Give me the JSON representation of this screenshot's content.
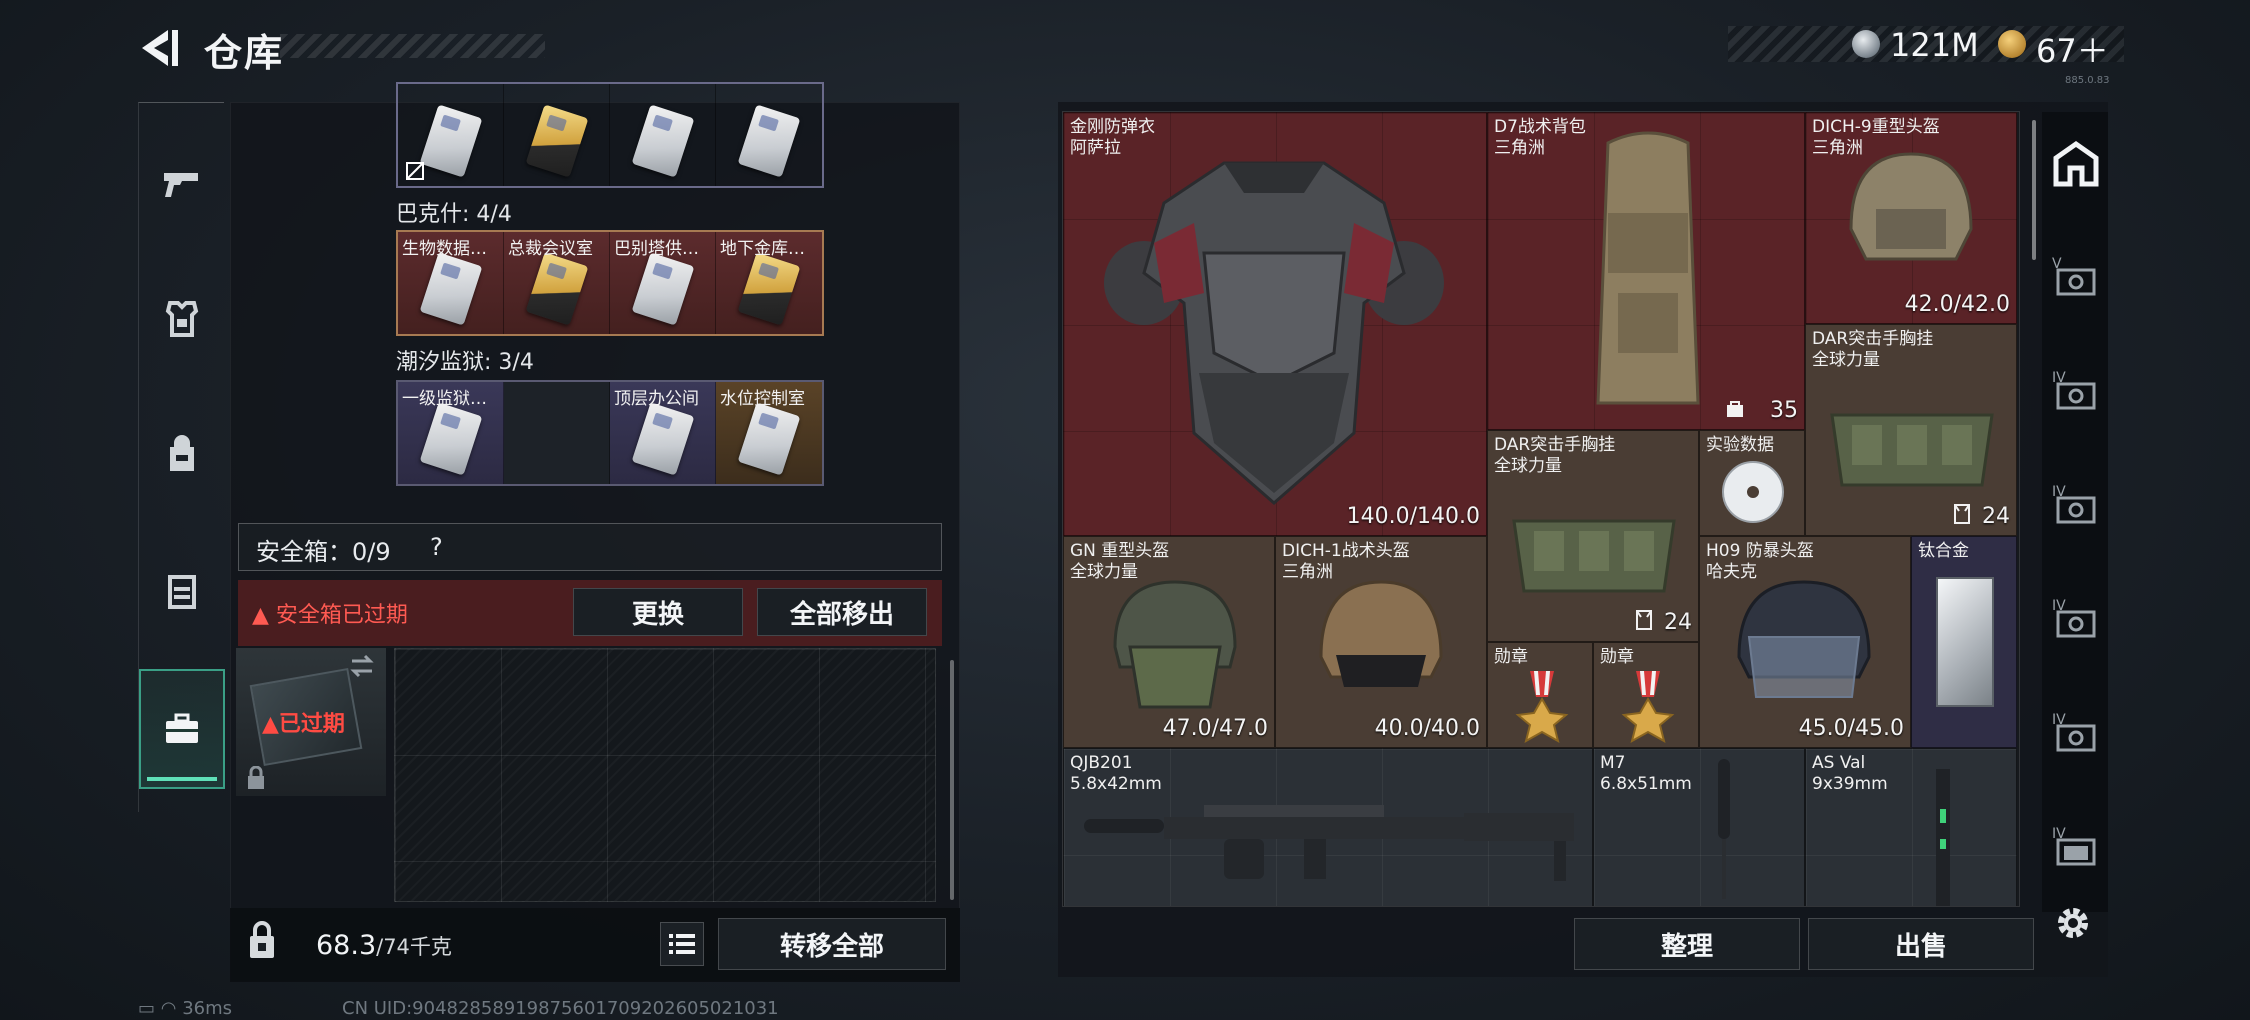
{
  "header": {
    "title": "仓库",
    "money": "121M",
    "tickets": "67＋",
    "version": "885.0.83"
  },
  "colors": {
    "accent_green": "#3a9f86",
    "alert_red": "#ff5a52",
    "legendary_red": "#5a2327",
    "epic_gold": "#5a4327",
    "rare_purple": "#3a3858"
  },
  "left_rail": {
    "tabs": [
      {
        "name": "weapons",
        "icon": "pistol-icon"
      },
      {
        "name": "armor",
        "icon": "armor-icon"
      },
      {
        "name": "backpack",
        "icon": "backpack-icon"
      },
      {
        "name": "chest-rig",
        "icon": "chest-rig-icon"
      },
      {
        "name": "safe-box",
        "icon": "briefcase-icon",
        "active": true
      }
    ]
  },
  "keycards": {
    "group0": {
      "cards": [
        {
          "label": "",
          "rarity": "purple"
        },
        {
          "label": "",
          "rarity": "gold"
        },
        {
          "label": "",
          "rarity": "purple"
        },
        {
          "label": "",
          "rarity": "gold"
        }
      ]
    },
    "group1": {
      "title": "巴克什: 4/4",
      "cards": [
        {
          "label": "生物数据…",
          "rarity": "red"
        },
        {
          "label": "总裁会议室",
          "rarity": "red"
        },
        {
          "label": "巴别塔供…",
          "rarity": "red"
        },
        {
          "label": "地下金库…",
          "rarity": "red"
        }
      ]
    },
    "group2": {
      "title": "潮汐监狱: 3/4",
      "cards": [
        {
          "label": "一级监狱…",
          "rarity": "purple"
        },
        {
          "label": "",
          "rarity": "empty"
        },
        {
          "label": "顶层办公间",
          "rarity": "purple"
        },
        {
          "label": "水位控制室",
          "rarity": "gold"
        }
      ]
    }
  },
  "safe_box": {
    "title": "安全箱：0/9",
    "help": "?",
    "expired_notice": "安全箱已过期",
    "replace_label": "更换",
    "move_all_label": "全部移出",
    "case_status": "已过期"
  },
  "left_footer": {
    "weight": "68.3",
    "weight_limit": "/74千克",
    "transfer_all_label": "转移全部"
  },
  "inventory": {
    "items": [
      {
        "name": "金刚防弹衣",
        "sub": "阿萨拉",
        "dur": "140.0/140.0",
        "rarity": "red"
      },
      {
        "name": "D7战术背包",
        "sub": "三角洲",
        "count": "35",
        "rarity": "red"
      },
      {
        "name": "DICH-9重型头盔",
        "sub": "三角洲",
        "dur": "42.0/42.0",
        "rarity": "red"
      },
      {
        "name": "DAR突击手胸挂",
        "sub": "全球力量",
        "count": "24",
        "rarity": "brown"
      },
      {
        "name": "DAR突击手胸挂",
        "sub": "全球力量",
        "count": "24",
        "rarity": "brown"
      },
      {
        "name": "实验数据",
        "sub": "",
        "rarity": "brown"
      },
      {
        "name": "GN 重型头盔",
        "sub": "全球力量",
        "dur": "47.0/47.0",
        "rarity": "brown"
      },
      {
        "name": "DICH-1战术头盔",
        "sub": "三角洲",
        "dur": "40.0/40.0",
        "rarity": "brown"
      },
      {
        "name": "勋章",
        "sub": "",
        "rarity": "brown"
      },
      {
        "name": "勋章",
        "sub": "",
        "rarity": "brown"
      },
      {
        "name": "H09 防暴头盔",
        "sub": "哈夫克",
        "dur": "45.0/45.0",
        "rarity": "brown"
      },
      {
        "name": "钛合金",
        "sub": "",
        "rarity": "purple"
      },
      {
        "name": "QJB201",
        "sub": "5.8x42mm",
        "rarity": "gray"
      },
      {
        "name": "M7",
        "sub": "6.8x51mm",
        "rarity": "gray"
      },
      {
        "name": "AS Val",
        "sub": "9x39mm",
        "rarity": "gray"
      }
    ]
  },
  "right_footer": {
    "organize_label": "整理",
    "sell_label": "出售"
  },
  "right_rail": {
    "tabs": [
      "home-icon",
      "case-tier-v-icon",
      "case-tier-iv-icon",
      "case-tier-iv-icon",
      "case-tier-iv-icon",
      "case-tier-iv-icon",
      "case-tier-iv-icon"
    ]
  },
  "status": {
    "ping": "36ms",
    "uid": "CN UID:904828589198756017092026050210​31"
  }
}
